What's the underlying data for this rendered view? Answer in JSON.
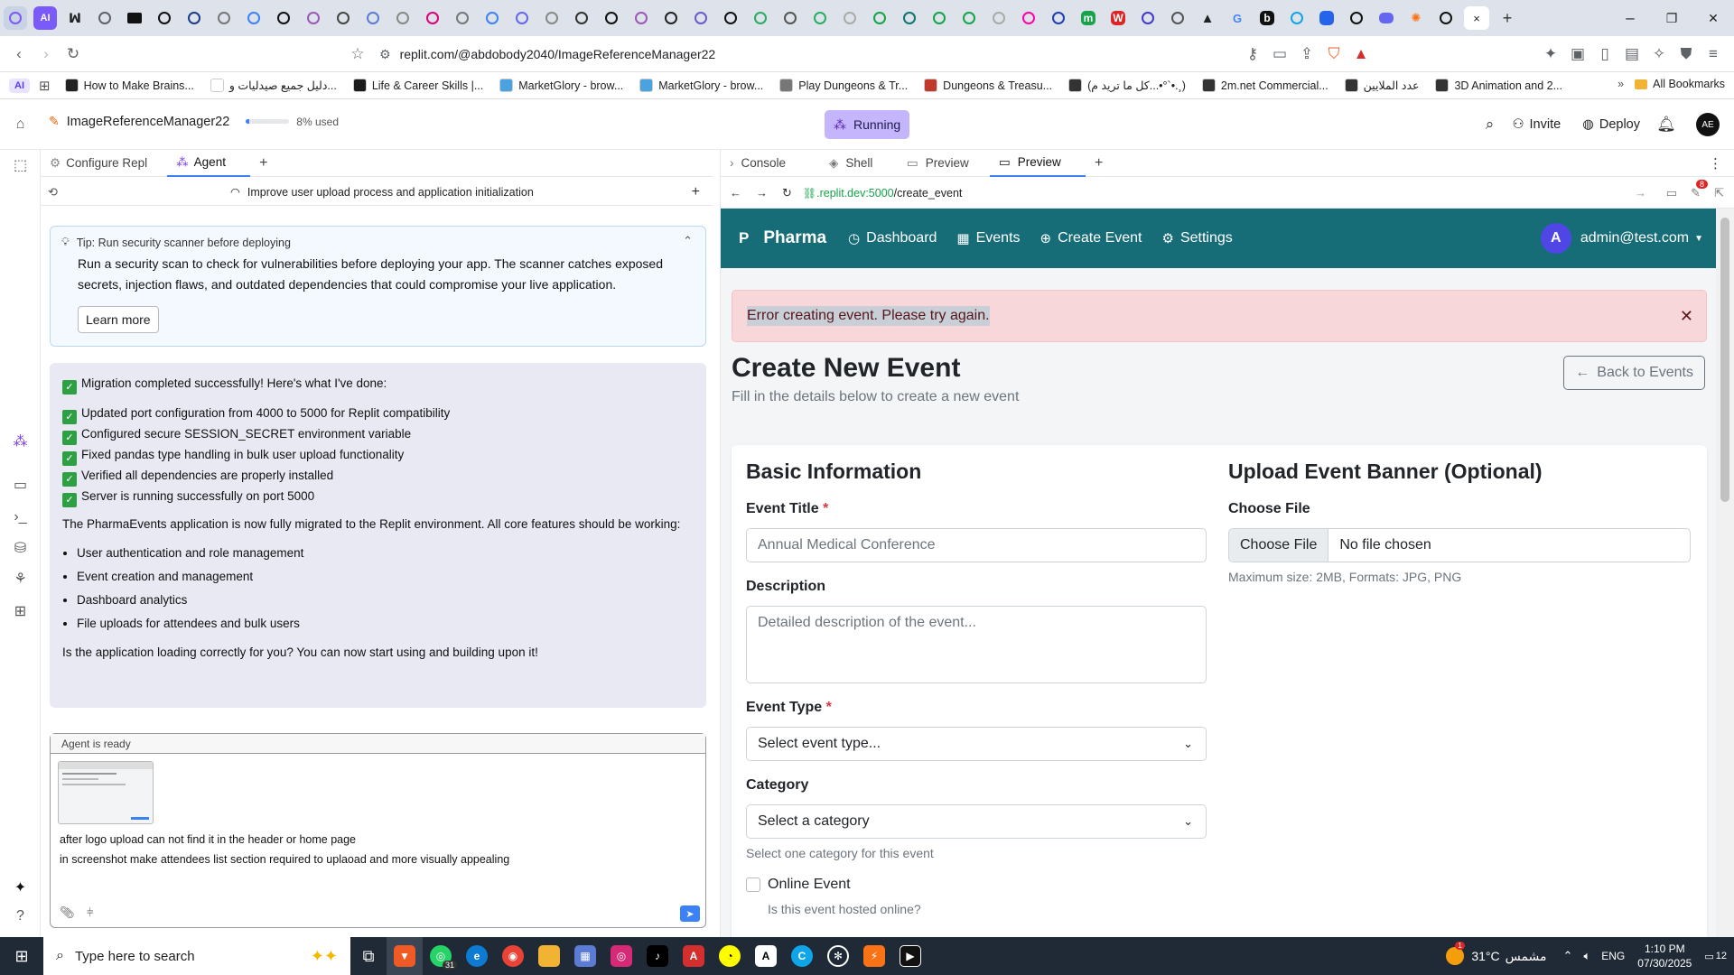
{
  "browser": {
    "tab_close": "×",
    "new_tab": "+",
    "window_min": "–",
    "window_max": "❐",
    "window_close": "✕",
    "url": "replit.com/@abdobody2040/ImageReferenceManager22",
    "ai_chip": "AI"
  },
  "bookmarks": [
    {
      "label": "How to Make Brains...",
      "color": "#222"
    },
    {
      "label": "دليل جميع صيدليات و...",
      "color": "#ffffff"
    },
    {
      "label": "Life & Career Skills |...",
      "color": "#1b1b1b"
    },
    {
      "label": "MarketGlory - brow...",
      "color": "#4aa3df"
    },
    {
      "label": "MarketGlory - brow...",
      "color": "#4aa3df"
    },
    {
      "label": "Play Dungeons & Tr...",
      "color": "#777"
    },
    {
      "label": "Dungeons & Treasu...",
      "color": "#c0392b"
    },
    {
      "label": "(كل ما تريد م...•°`•.¸)",
      "color": "#333"
    },
    {
      "label": "2m.net Commercial...",
      "color": "#333"
    },
    {
      "label": "عدد الملايين",
      "color": "#333"
    },
    {
      "label": "3D Animation and 2...",
      "color": "#333"
    }
  ],
  "all_bookmarks": "All Bookmarks",
  "replit": {
    "project_name": "ImageReferenceManager22",
    "usage": "8% used",
    "usage_fraction": 0.08,
    "run_status": "Running",
    "invite": "Invite",
    "deploy": "Deploy",
    "avatar": "AE"
  },
  "left_tabs": {
    "configure": "Configure Repl",
    "agent": "Agent",
    "add": "+"
  },
  "agent_topbar": {
    "title": "Improve user upload process and application initialization",
    "plus": "+"
  },
  "tip": {
    "title": "Tip: Run security scanner before deploying",
    "body": "Run a security scan to check for vulnerabilities before deploying your app. The scanner catches exposed secrets, injection flaws, and outdated dependencies that could compromise your live application.",
    "button": "Learn more",
    "collapse": "⌃"
  },
  "chat": {
    "intro": "Migration completed successfully! Here's what I've done:",
    "checks": [
      "Updated port configuration from 4000 to 5000 for Replit compatibility",
      "Configured secure SESSION_SECRET environment variable",
      "Fixed pandas type handling in bulk user upload functionality",
      "Verified all dependencies are properly installed",
      "Server is running successfully on port 5000"
    ],
    "summary": "The PharmaEvents application is now fully migrated to the Replit environment. All core features should be working:",
    "bullets": [
      "User authentication and role management",
      "Event creation and management",
      "Dashboard analytics",
      "File uploads for attendees and bulk users"
    ],
    "closing": "Is the application loading correctly for you? You can now start using and building upon it!"
  },
  "input": {
    "status": "Agent is ready",
    "line1": "after logo upload can not find it in the header or home page",
    "line2": "in screenshot make attendees list section required to uplaoad and more visually appealing"
  },
  "right_tabs": {
    "console": "Console",
    "shell": "Shell",
    "preview1": "Preview",
    "preview2": "Preview",
    "add": "+",
    "more": "⋮"
  },
  "preview_url": {
    "host": ".replit.dev:5000",
    "path": "/create_event",
    "badge": "8"
  },
  "app": {
    "brand_letter": "P",
    "brand": "Pharma",
    "nav": [
      {
        "icon": "◷",
        "label": "Dashboard"
      },
      {
        "icon": "▦",
        "label": "Events"
      },
      {
        "icon": "⊕",
        "label": "Create Event"
      },
      {
        "icon": "⚙",
        "label": "Settings"
      }
    ],
    "user_initial": "A",
    "user_email": "admin@test.com",
    "nav_bg": "#166d78",
    "alert": "Error creating event. Please try again.",
    "alert_close": "✕",
    "page_title": "Create New Event",
    "page_subtitle": "Fill in the details below to create a new event",
    "back_button": "Back to Events",
    "basic_heading": "Basic Information",
    "title_label": "Event Title",
    "title_placeholder": "Annual Medical Conference",
    "desc_label": "Description",
    "desc_placeholder": "Detailed description of the event...",
    "type_label": "Event Type",
    "type_value": "Select event type...",
    "cat_label": "Category",
    "cat_value": "Select a category",
    "cat_help": "Select one category for this event",
    "online_label": "Online Event",
    "online_help": "Is this event hosted online?",
    "required_mark": "*",
    "banner_heading": "Upload Event Banner (Optional)",
    "file_label": "Choose File",
    "file_button": "Choose File",
    "file_status": "No file chosen",
    "file_help": "Maximum size: 2MB, Formats: JPG, PNG"
  },
  "taskbar": {
    "search": "Type here to search",
    "whatsapp_badge": "31",
    "weather_temp": "31°C",
    "weather_desc": "مشمس",
    "weather_badge": "1",
    "lang": "ENG",
    "time": "1:10 PM",
    "date": "07/30/2025",
    "notif": "12"
  }
}
